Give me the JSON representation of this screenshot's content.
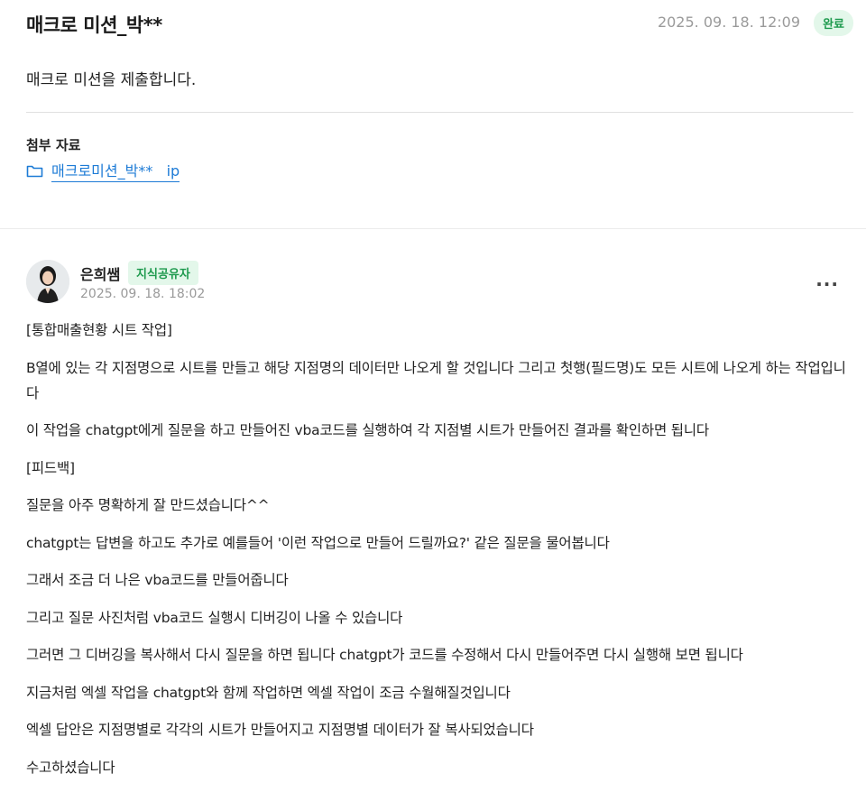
{
  "post": {
    "title": "매크로 미션_박**",
    "date": "2025. 09. 18. 12:09",
    "status": "완료",
    "body": "매크로 미션을 제출합니다."
  },
  "attachments": {
    "heading": "첨부 자료",
    "file_name": "매크로미션_박**   ip",
    "icon": "folder-icon"
  },
  "comment": {
    "author": "은희쌤",
    "badge": "지식공유자",
    "date": "2025. 09. 18. 18:02",
    "more": "···",
    "lines": [
      "[통합매출현황 시트 작업]",
      "B열에 있는 각 지점명으로 시트를 만들고 해당 지점명의 데이터만 나오게 할 것입니다 그리고 첫행(필드명)도 모든 시트에 나오게 하는 작업입니다",
      "이 작업을 chatgpt에게 질문을 하고 만들어진 vba코드를 실행하여 각 지점별 시트가 만들어진 결과를 확인하면 됩니다",
      "[피드백]",
      "질문을 아주 명확하게 잘 만드셨습니다^^",
      "chatgpt는 답변을 하고도 추가로 예를들어 '이런 작업으로 만들어 드릴까요?' 같은 질문을 물어봅니다",
      "그래서 조금 더 나은 vba코드를 만들어줍니다",
      "그리고 질문 사진처럼 vba코드 실행시 디버깅이 나올 수 있습니다",
      "그러면 그 디버깅을 복사해서 다시 질문을 하면 됩니다 chatgpt가 코드를 수정해서 다시 만들어주면 다시 실행해 보면 됩니다",
      "지금처럼 엑셀 작업을 chatgpt와 함께 작업하면 엑셀 작업이 조금 수월해질것입니다",
      "엑셀 답안은 지점명별로 각각의 시트가 만들어지고 지점명별 데이터가 잘 복사되었습니다",
      "수고하셨습니다"
    ]
  },
  "colors": {
    "accent_green": "#1e9a4e",
    "badge_bg": "#e3f7ea",
    "link_blue": "#1d7bd6",
    "muted_gray": "#9a9a9a"
  }
}
